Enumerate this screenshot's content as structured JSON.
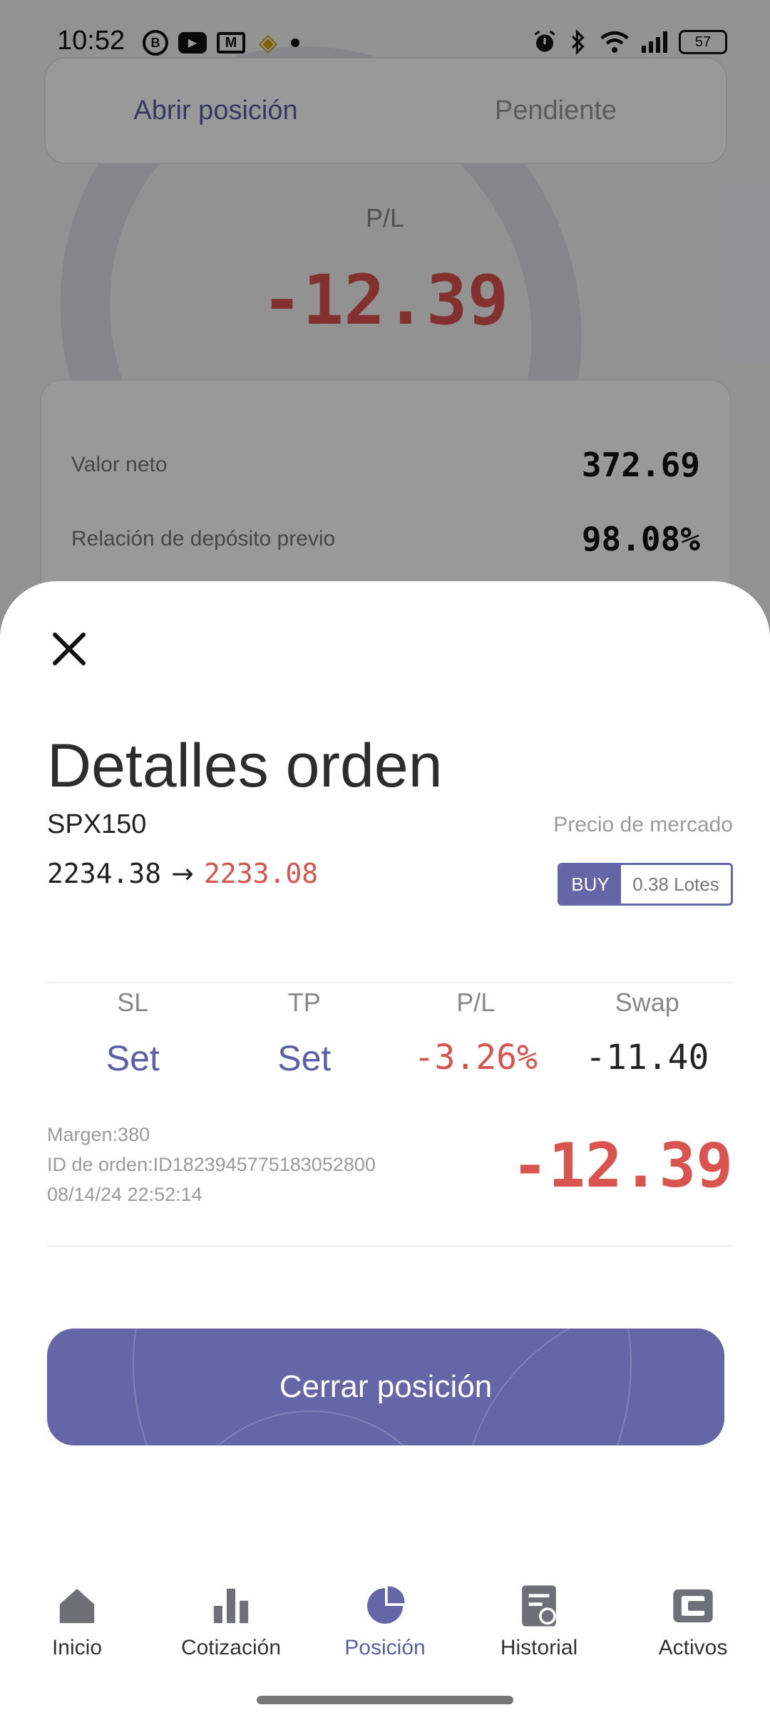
{
  "status_bar": {
    "time": "10:52",
    "battery": "57",
    "left_icons": [
      "b-icon",
      "youtube-icon",
      "mail-icon",
      "binance-icon",
      "dot-icon"
    ],
    "right_icons": [
      "alarm-icon",
      "bluetooth-icon",
      "wifi-icon",
      "signal-icon",
      "battery-icon"
    ]
  },
  "background": {
    "tabs": [
      {
        "label": "Abrir posición",
        "active": true
      },
      {
        "label": "Pendiente",
        "active": false
      }
    ],
    "pl_label": "P/L",
    "pl_value": "-12.39",
    "summary": [
      {
        "label": "Valor neto",
        "value": "372.69"
      },
      {
        "label": "Relación de depósito previo",
        "value": "98.08%"
      }
    ]
  },
  "sheet": {
    "title": "Detalles orden",
    "symbol": "SPX150",
    "price_from": "2234.38",
    "price_arrow": "→",
    "price_to": "2233.08",
    "market_label": "Precio de mercado",
    "side": "BUY",
    "lots": "0.38 Lotes",
    "columns": [
      {
        "header": "SL",
        "value": "Set",
        "kind": "set"
      },
      {
        "header": "TP",
        "value": "Set",
        "kind": "set"
      },
      {
        "header": "P/L",
        "value": "-3.26%",
        "kind": "red"
      },
      {
        "header": "Swap",
        "value": "-11.40",
        "kind": "dark"
      }
    ],
    "meta": {
      "margin": "Margen:380",
      "order_id": "ID de orden:ID1823945775183052800",
      "timestamp": "08/14/24 22:52:14"
    },
    "pl_value": "-12.39",
    "close_button": "Cerrar posición"
  },
  "nav": [
    {
      "label": "Inicio",
      "icon": "home-icon",
      "active": false
    },
    {
      "label": "Cotización",
      "icon": "bar-chart-icon",
      "active": false
    },
    {
      "label": "Posición",
      "icon": "pie-chart-icon",
      "active": true
    },
    {
      "label": "Historial",
      "icon": "history-icon",
      "active": false
    },
    {
      "label": "Activos",
      "icon": "wallet-icon",
      "active": false
    }
  ],
  "colors": {
    "accent": "#6466a8",
    "negative": "#d9534f",
    "text": "#222222"
  }
}
